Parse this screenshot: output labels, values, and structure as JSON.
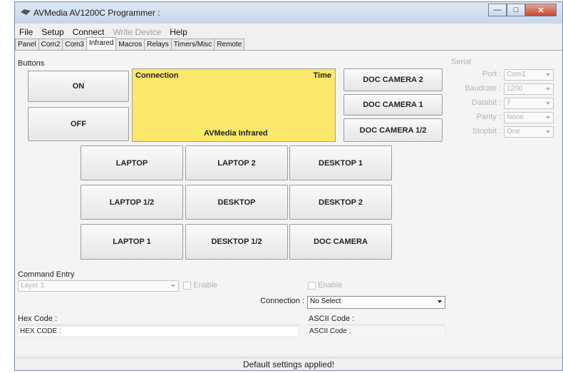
{
  "window": {
    "title": "AVMedia AV1200C Programmer :"
  },
  "menu": {
    "file": "File",
    "setup": "Setup",
    "connect": "Connect",
    "write_device": "Write Device",
    "help": "Help"
  },
  "tabs": [
    "Panel",
    "Com2",
    "Com3",
    "Infrared",
    "Macros",
    "Relays",
    "Timers/Misc",
    "Remote"
  ],
  "active_tab": "Infrared",
  "buttons_group": {
    "label": "Buttons",
    "on": "ON",
    "off": "OFF",
    "status": {
      "connection": "Connection",
      "time": "Time",
      "device": "AVMedia Infrared",
      "color": "#fbe86a"
    },
    "right": [
      "DOC CAMERA 2",
      "DOC CAMERA 1",
      "DOC CAMERA 1/2"
    ],
    "grid": [
      [
        "LAPTOP",
        "LAPTOP 2",
        "DESKTOP 1"
      ],
      [
        "LAPTOP 1/2",
        "DESKTOP",
        "DESKTOP 2"
      ],
      [
        "LAPTOP 1",
        "DESKTOP 1/2",
        "DOC CAMERA"
      ]
    ]
  },
  "serial": {
    "label": "Serial",
    "rows": [
      {
        "label": "Port :",
        "value": "Com1"
      },
      {
        "label": "Baudrate :",
        "value": "1200"
      },
      {
        "label": "Databit :",
        "value": "7"
      },
      {
        "label": "Parity :",
        "value": "None"
      },
      {
        "label": "Stopbit :",
        "value": "One"
      }
    ]
  },
  "command_entry": {
    "label": "Command Entry",
    "layer": "Layer 1",
    "enable_left": "Enable",
    "enable_right": "Enable",
    "connection_label": "Connection :",
    "connection_value": "No Select",
    "hex_label": "Hex Code :",
    "hex_value": "HEX CODE :",
    "ascii_label": "ASCII Code :",
    "ascii_value": "ASCII Code :"
  },
  "status_message": "Default settings applied!"
}
